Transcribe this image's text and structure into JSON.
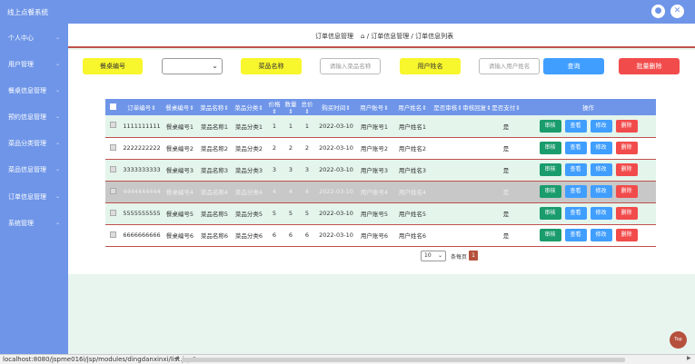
{
  "app": {
    "title": "线上点餐系统"
  },
  "topbar": {
    "icon_left": "user-icon",
    "icon_right": "close-icon"
  },
  "sidebar": {
    "items": [
      {
        "label": "个人中心"
      },
      {
        "label": "用户管理"
      },
      {
        "label": "餐桌信息管理"
      },
      {
        "label": "预约信息管理"
      },
      {
        "label": "菜品分类管理"
      },
      {
        "label": "菜品信息管理"
      },
      {
        "label": "订单信息管理"
      },
      {
        "label": "系统管理"
      }
    ]
  },
  "header": {
    "page": "订单信息管理",
    "breadcrumb": "/ 订单信息管理 / 订单信息列表"
  },
  "search": {
    "table_no_label": "餐桌编号",
    "dish_name_label": "菜品名称",
    "dish_name_placeholder": "请输入菜品名称",
    "user_name_label": "用户姓名",
    "user_name_placeholder": "请输入用户姓名",
    "query_button": "查询",
    "batch_delete_button": "批量删除"
  },
  "table": {
    "columns": [
      "订单编号",
      "餐桌编号",
      "菜品名称",
      "菜品分类",
      "价格",
      "数量",
      "总价",
      "购买时间",
      "用户账号",
      "用户姓名",
      "是否审核",
      "审核回复",
      "是否支付",
      "操作"
    ],
    "actions": {
      "audit": "审核",
      "view": "查看",
      "edit": "修改",
      "delete": "删除"
    },
    "rows": [
      {
        "order_no": "1111111111",
        "table_no": "餐桌编号1",
        "dish": "菜品名称1",
        "category": "菜品分类1",
        "price": "1",
        "qty": "1",
        "total": "1",
        "time": "2022-03-10",
        "account": "用户账号1",
        "name": "用户姓名1",
        "audited": "",
        "reply": "",
        "paid": "是"
      },
      {
        "order_no": "2222222222",
        "table_no": "餐桌编号2",
        "dish": "菜品名称2",
        "category": "菜品分类2",
        "price": "2",
        "qty": "2",
        "total": "2",
        "time": "2022-03-10",
        "account": "用户账号2",
        "name": "用户姓名2",
        "audited": "",
        "reply": "",
        "paid": "是"
      },
      {
        "order_no": "3333333333",
        "table_no": "餐桌编号3",
        "dish": "菜品名称3",
        "category": "菜品分类3",
        "price": "3",
        "qty": "3",
        "total": "3",
        "time": "2022-03-10",
        "account": "用户账号3",
        "name": "用户姓名3",
        "audited": "",
        "reply": "",
        "paid": "是"
      },
      {
        "order_no": "4444444444",
        "table_no": "餐桌编号4",
        "dish": "菜品名称4",
        "category": "菜品分类4",
        "price": "4",
        "qty": "4",
        "total": "4",
        "time": "2022-03-10",
        "account": "用户账号4",
        "name": "用户姓名4",
        "audited": "",
        "reply": "",
        "paid": "是"
      },
      {
        "order_no": "5555555555",
        "table_no": "餐桌编号5",
        "dish": "菜品名称5",
        "category": "菜品分类5",
        "price": "5",
        "qty": "5",
        "total": "5",
        "time": "2022-03-10",
        "account": "用户账号5",
        "name": "用户姓名5",
        "audited": "",
        "reply": "",
        "paid": "是"
      },
      {
        "order_no": "6666666666",
        "table_no": "餐桌编号6",
        "dish": "菜品名称6",
        "category": "菜品分类6",
        "price": "6",
        "qty": "6",
        "total": "6",
        "time": "2022-03-10",
        "account": "用户账号6",
        "name": "用户姓名6",
        "audited": "",
        "reply": "",
        "paid": "是"
      }
    ]
  },
  "pager": {
    "page_size": "10",
    "per_page_text": "条每页",
    "current_page": "1"
  },
  "statusbar": {
    "url": "localhost:8080/jspme016i/jsp/modules/dingdanxinxi/list.jsp#"
  },
  "back_to_top": "Top",
  "colors": {
    "primary": "#6e95e8",
    "accent_red": "#c0504d",
    "label_yellow": "#f8f62c",
    "button_blue": "#409eff",
    "button_red": "#f24b4b",
    "audit_green": "#1a9c6c"
  }
}
